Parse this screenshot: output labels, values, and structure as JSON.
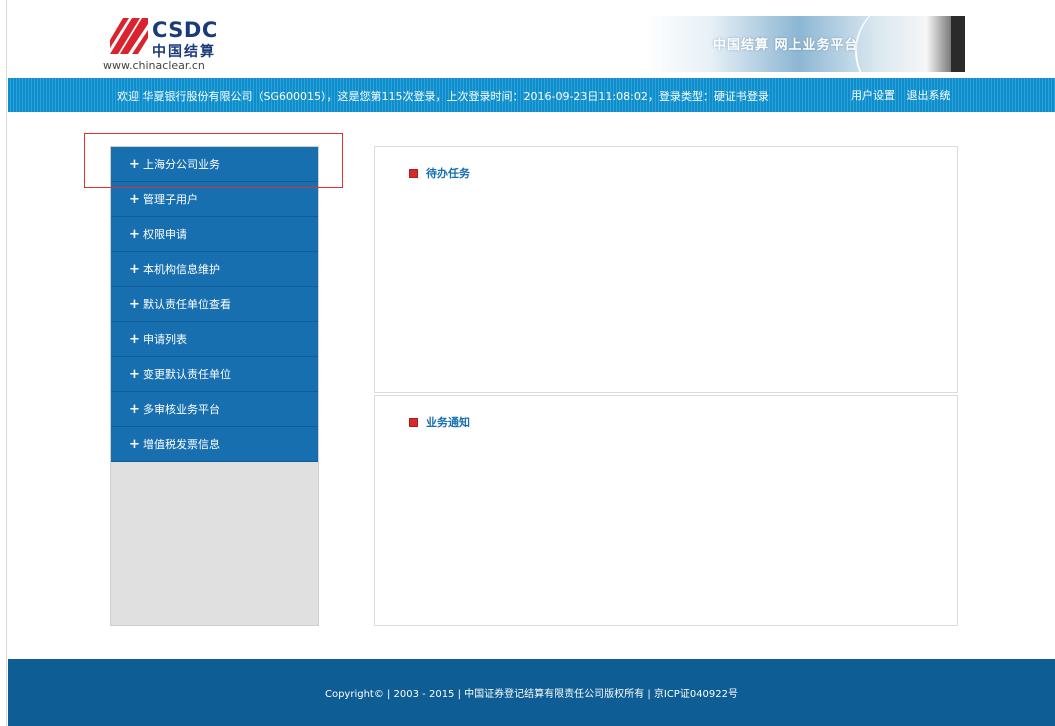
{
  "header": {
    "logo_en": "CSDC",
    "logo_cn": "中国结算",
    "logo_url": "www.chinaclear.cn",
    "banner_text": "中国结算 网上业务平台"
  },
  "infobar": {
    "welcome": "欢迎 华夏银行股份有限公司（SG600015），这是您第115次登录，上次登录时间：2016-09-23日11:08:02，登录类型：硬证书登录",
    "user_settings": "用户设置",
    "logout": "退出系统"
  },
  "sidebar": {
    "items": [
      {
        "label": "上海分公司业务"
      },
      {
        "label": "管理子用户"
      },
      {
        "label": "权限申请"
      },
      {
        "label": "本机构信息维护"
      },
      {
        "label": "默认责任单位查看"
      },
      {
        "label": "申请列表"
      },
      {
        "label": "变更默认责任单位"
      },
      {
        "label": "多审核业务平台"
      },
      {
        "label": "增值税发票信息"
      }
    ]
  },
  "panels": {
    "todo_title": "待办任务",
    "notice_title": "业务通知"
  },
  "footer": {
    "text": "Copyright© | 2003 - 2015 | 中国证券登记结算有限责任公司版权所有 | 京ICP证040922号"
  },
  "colors": {
    "infobar": "#0f8dcb",
    "menu": "#176fb0",
    "footer": "#0e5d95",
    "highlight": "#e03030",
    "title_marker": "#d72b2b"
  },
  "icons": {
    "menu_expand": "plus-icon",
    "panel_marker": "red-square-icon"
  }
}
